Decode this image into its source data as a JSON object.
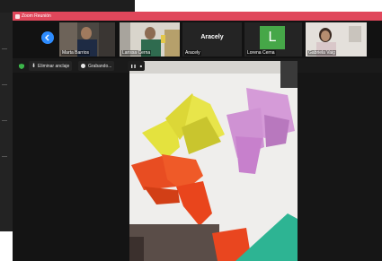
{
  "window": {
    "title": "Zoom Reunión"
  },
  "participants": [
    {
      "name": "Marta Barrios"
    },
    {
      "name": "Larissa Cerna"
    },
    {
      "name": "Aracely",
      "display": "Aracely"
    },
    {
      "name": "Lorena Cerna",
      "avatar_letter": "L"
    },
    {
      "name": "Gabriela Vaig"
    }
  ],
  "toolbar": {
    "unpin_label": "Eliminar anclaje",
    "recording_label": "Grabando...",
    "pause_label": "❚❚",
    "stop_label": "■"
  },
  "colors": {
    "titlebar": "#e0475b",
    "accent": "#2d8cff",
    "avatar_green": "#46a748"
  }
}
